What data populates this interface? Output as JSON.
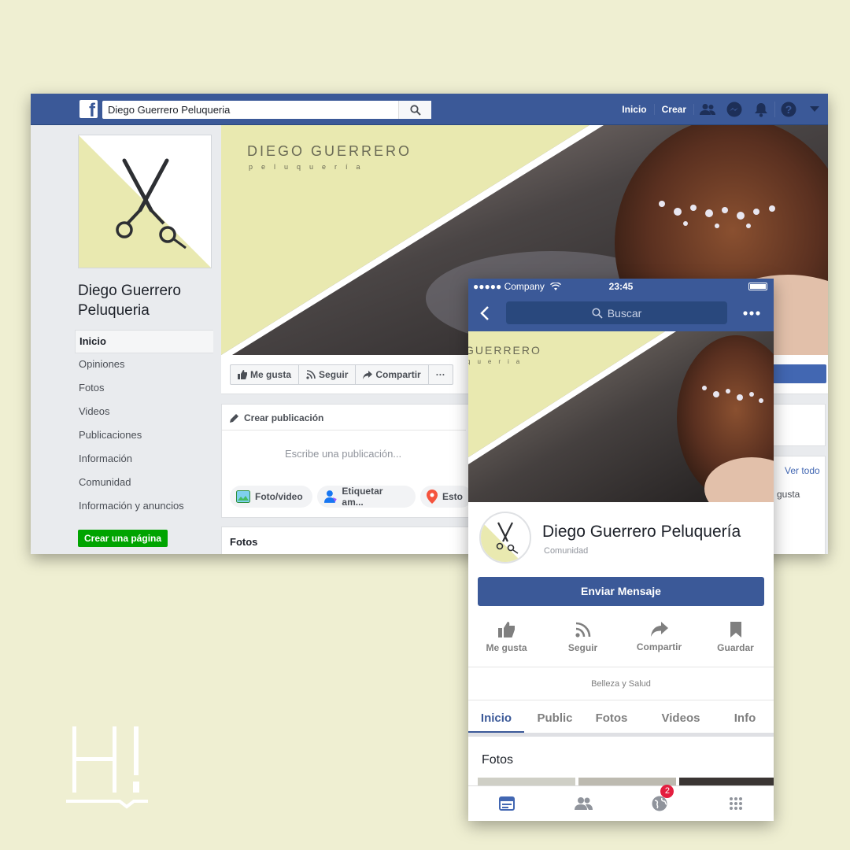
{
  "desktop": {
    "search_value": "Diego Guerrero Peluqueria",
    "nav": {
      "home": "Inicio",
      "create": "Crear"
    },
    "page_name": "Diego Guerrero Peluqueria",
    "menu": [
      "Inicio",
      "Opiniones",
      "Fotos",
      "Videos",
      "Publicaciones",
      "Información",
      "Comunidad",
      "Información y anuncios"
    ],
    "create_page": "Crear una página",
    "cover": {
      "brand": "DIEGO GUERRERO",
      "brand_sub": "peluquería"
    },
    "actions": {
      "like": "Me gusta",
      "follow": "Seguir",
      "share": "Compartir",
      "more": "···"
    },
    "composer": {
      "title": "Crear publicación",
      "placeholder": "Escribe una publicación...",
      "photo": "Foto/video",
      "tag": "Etiquetar am...",
      "checkin": "Esto"
    },
    "fotos": "Fotos",
    "see_all": "Ver todo",
    "likes_fragment": "gusta"
  },
  "mobile": {
    "carrier": "●●●●● Company",
    "time": "23:45",
    "search_placeholder": "Buscar",
    "cover": {
      "brand": "GUERRERO",
      "brand_sub": "queria"
    },
    "page_name": "Diego Guerrero Peluquería",
    "page_type": "Comunidad",
    "send_message": "Enviar Mensaje",
    "actions": [
      "Me gusta",
      "Seguir",
      "Compartir",
      "Guardar"
    ],
    "category": "Belleza y Salud",
    "tabs": [
      "Inicio",
      "Public",
      "Fotos",
      "Videos",
      "Info"
    ],
    "fotos": "Fotos",
    "notification_count": "2"
  },
  "colors": {
    "fb_blue": "#3b5998",
    "page_bg": "#efefd2",
    "cover_yellow": "#e9e9b0",
    "green": "#00a400",
    "badge_red": "#e41e3f"
  },
  "logo": {
    "text": "H!"
  }
}
